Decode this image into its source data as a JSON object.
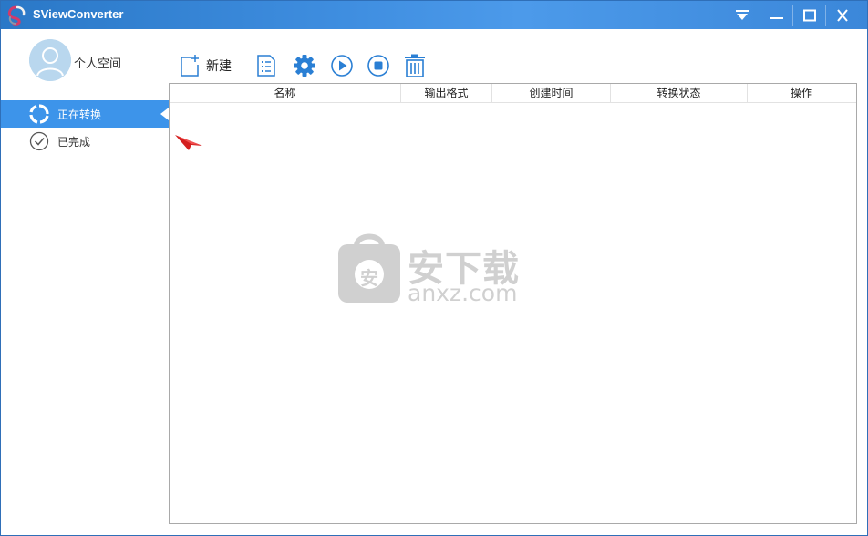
{
  "window": {
    "title": "SViewConverter",
    "controls": [
      "menu",
      "minimize",
      "maximize",
      "close"
    ]
  },
  "sidebar": {
    "user_label": "个人空间",
    "items": [
      {
        "label": "正在转换",
        "icon": "converting-ring-icon",
        "active": true
      },
      {
        "label": "已完成",
        "icon": "check-circle-icon",
        "active": false
      }
    ]
  },
  "toolbar": {
    "new_label": "新建",
    "buttons": [
      "new-file-icon",
      "document-list-icon",
      "gear-icon",
      "play-icon",
      "stop-icon",
      "trash-icon"
    ]
  },
  "table": {
    "columns": [
      "名称",
      "输出格式",
      "创建时间",
      "转换状态",
      "操作"
    ],
    "rows": []
  },
  "watermark": {
    "cn": "安下载",
    "en": "anxz.com",
    "badge": "安"
  },
  "colors": {
    "accent": "#3d94ea",
    "icon_blue": "#2a7fd4",
    "titlebar": "#3f8ee0",
    "pointer_red": "#d42020"
  }
}
